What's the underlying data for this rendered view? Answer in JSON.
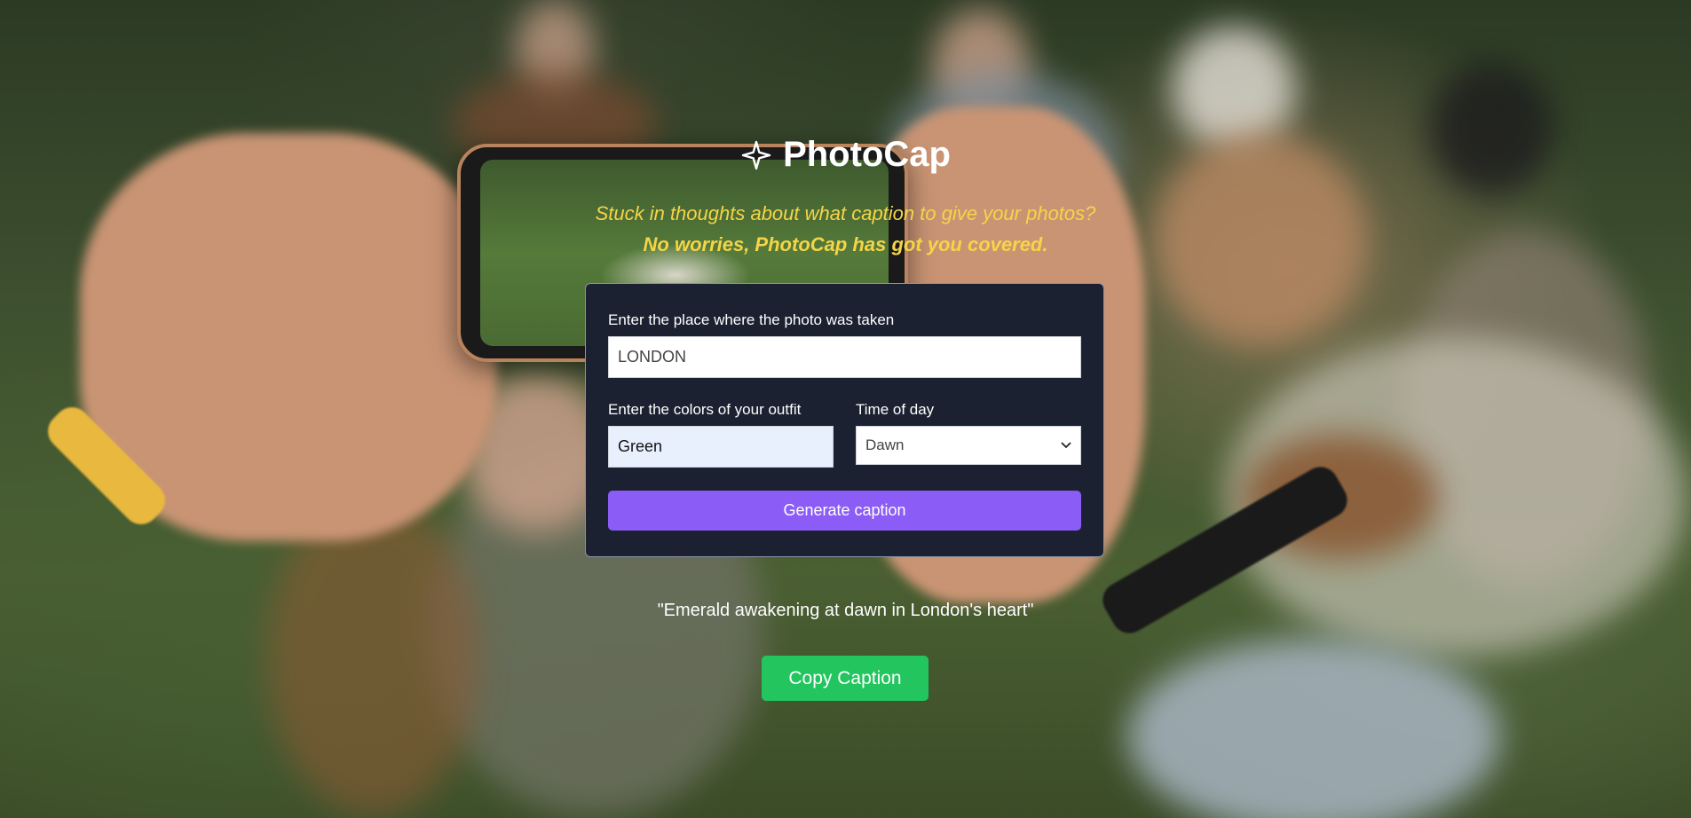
{
  "brand": {
    "name": "PhotoCap",
    "icon": "sparkle-icon"
  },
  "tagline": {
    "line1": "Stuck in thoughts about what caption to give your photos?",
    "line2": "No worries, PhotoCap has got you covered."
  },
  "form": {
    "place_label": "Enter the place where the photo was taken",
    "place_value": "LONDON",
    "colors_label": "Enter the colors of your outfit",
    "colors_value": "Green",
    "time_label": "Time of day",
    "time_value": "Dawn",
    "generate_label": "Generate caption"
  },
  "result": {
    "caption": "\"Emerald awakening at dawn in London's heart\"",
    "copy_label": "Copy Caption"
  },
  "colors": {
    "accent_purple": "#8b5cf6",
    "copy_green": "#22c55e",
    "tagline_yellow": "#f5d547",
    "card_bg": "#1b2131"
  }
}
